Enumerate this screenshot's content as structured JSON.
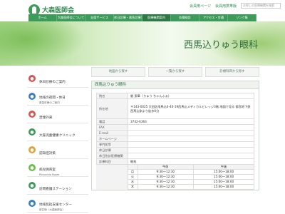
{
  "header": {
    "logo_text": "大森医師会",
    "logo_sub": "Omori Medical Association",
    "links": [
      "会員用ページ",
      "会員用携帯版"
    ],
    "search_placeholder": "お探しの医療機関を検索"
  },
  "nav": [
    "ホーム",
    "大森医師会について",
    "支援サービス",
    "休日診療・救急診療案内",
    "医療機関案内",
    "各種検診",
    "アクセス・交通",
    "リンク集"
  ],
  "hero": {
    "title": "西馬込りゅう眼科"
  },
  "sidebar": [
    {
      "label": "休日診療のご案内",
      "sub": "",
      "color": "#d9534f",
      "icon": "plus-icon"
    },
    {
      "label": "地域の夜間・休日",
      "sub": "救急診療のご案内",
      "color": "#3a7fc1",
      "icon": "clock-icon"
    },
    {
      "label": "禁煙外来",
      "sub": "",
      "color": "#d9534f",
      "icon": "no-smoking-icon"
    },
    {
      "label": "大森児童健康クリニック",
      "sub": "",
      "color": "#3d9a5a",
      "icon": "child-icon"
    },
    {
      "label": "認知症対策",
      "sub": "",
      "color": "#e2a23a",
      "icon": "brain-icon"
    },
    {
      "label": "病児保育室",
      "sub": "Pinocchio Room",
      "color": "#6cbf4a",
      "icon": "baby-icon"
    },
    {
      "label": "訪問看護ステーション",
      "sub": "",
      "color": "#3d9a5a",
      "icon": "nurse-icon"
    },
    {
      "label": "地域包括支援センター",
      "sub": "新井宿（大森医師会）",
      "color": "#3a7fc1",
      "icon": "house-icon"
    }
  ],
  "tabs": [
    "地図から探す",
    "一覧から探す",
    "診療科目から探す"
  ],
  "card": {
    "title": "西馬込りゅう眼科",
    "rows": [
      {
        "key": "院名",
        "value": "劉 潔華（りゅう ちゃんふぁ）"
      },
      {
        "key": "所在地",
        "value": "〒143-0025 大田区南馬込4-40-19西馬込メディカルビレッジ3階 地図で見る 都営地下鉄西馬込駅より徒歩0分"
      },
      {
        "key": "電話",
        "value": "3742-6363"
      },
      {
        "key": "FAX",
        "value": ""
      },
      {
        "key": "E-mail",
        "value": ""
      },
      {
        "key": "ホームページ",
        "value": ""
      },
      {
        "key": "専門医等",
        "value": ""
      },
      {
        "key": "休日診療",
        "value": ""
      },
      {
        "key": "休日急診医療機関",
        "value": ""
      }
    ],
    "subjects_key": "診療科目",
    "subjects_value": "眼科",
    "schedule_header": [
      "",
      "午前",
      "午後"
    ],
    "schedule": [
      [
        "月",
        "9:30～12:30",
        "15:00～18:00"
      ],
      [
        "火",
        "9:30～12:30",
        "15:00～18:00"
      ],
      [
        "水",
        "9:30～12:30",
        "15:00～18:00"
      ],
      [
        "木",
        "9:30～12:30",
        "15:00～18:00"
      ]
    ]
  }
}
